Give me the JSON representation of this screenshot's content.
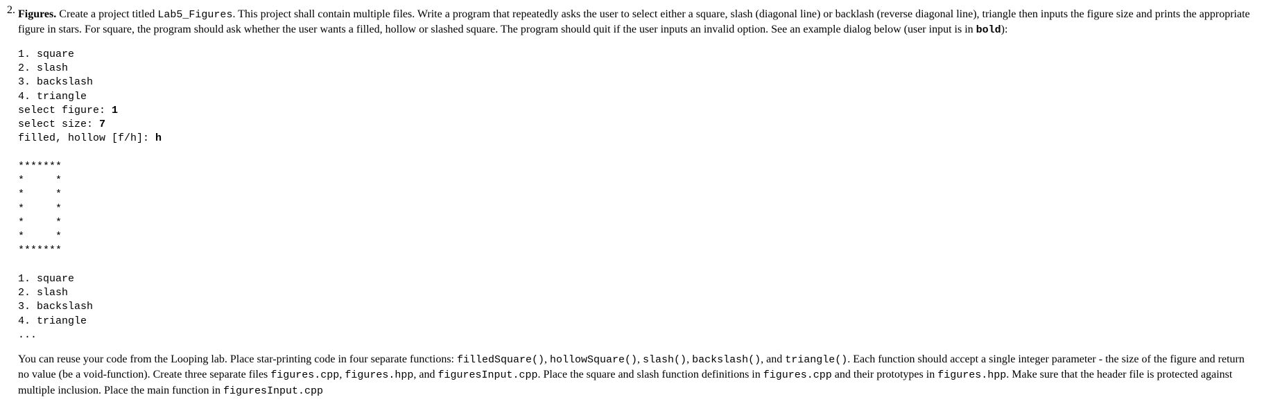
{
  "item_number": "2. ",
  "para1": {
    "heading": "Figures.",
    "t1": " Create a project titled ",
    "code1": "Lab5_Figures",
    "t2": ". This project shall contain multiple files. Write a program that repeatedly asks the user to select either a square, slash (diagonal line) or backlash (reverse diagonal line), triangle then inputs the figure size and prints the appropriate figure in stars. For square, the program should ask whether the user wants a filled, hollow or slashed square. The program should quit if the user inputs an invalid option. See an example dialog below (user input is in ",
    "code2": "bold",
    "t3": "):"
  },
  "dialog": {
    "l1": "1. square",
    "l2": "2. slash",
    "l3": "3. backslash",
    "l4": "4. triangle",
    "l5a": "select figure: ",
    "l5b": "1",
    "l6a": "select size: ",
    "l6b": "7",
    "l7a": "filled, hollow [f/h]: ",
    "l7b": "h",
    "blank1": "",
    "s1": "*******",
    "s2": "*     *",
    "s3": "*     *",
    "s4": "*     *",
    "s5": "*     *",
    "s6": "*     *",
    "s7": "*******",
    "blank2": "",
    "m1": "1. square",
    "m2": "2. slash",
    "m3": "3. backslash",
    "m4": "4. triangle",
    "m5": "..."
  },
  "para2": {
    "t1": "You can reuse your code from the Looping lab. Place star-printing code in four separate functions: ",
    "c1": "filledSquare()",
    "t2": ", ",
    "c2": "hollowSquare()",
    "t3": ", ",
    "c3": "slash()",
    "t4": ", ",
    "c4": "backslash()",
    "t5": ", and ",
    "c5": "triangle()",
    "t6": ". Each function should accept a single integer parameter - the size of the figure and return no value (be a void-function). Create three separate files ",
    "c6": "figures.cpp",
    "t7": ", ",
    "c7": "figures.hpp",
    "t8": ", and ",
    "c8": "figuresInput.cpp",
    "t9": ". Place the square and slash function definitions in ",
    "c9": "figures.cpp",
    "t10": " and their prototypes in ",
    "c10": "figures.hpp",
    "t11": ". Make sure that the header file is protected against multiple inclusion. Place the main function in ",
    "c11": "figuresInput.cpp"
  }
}
